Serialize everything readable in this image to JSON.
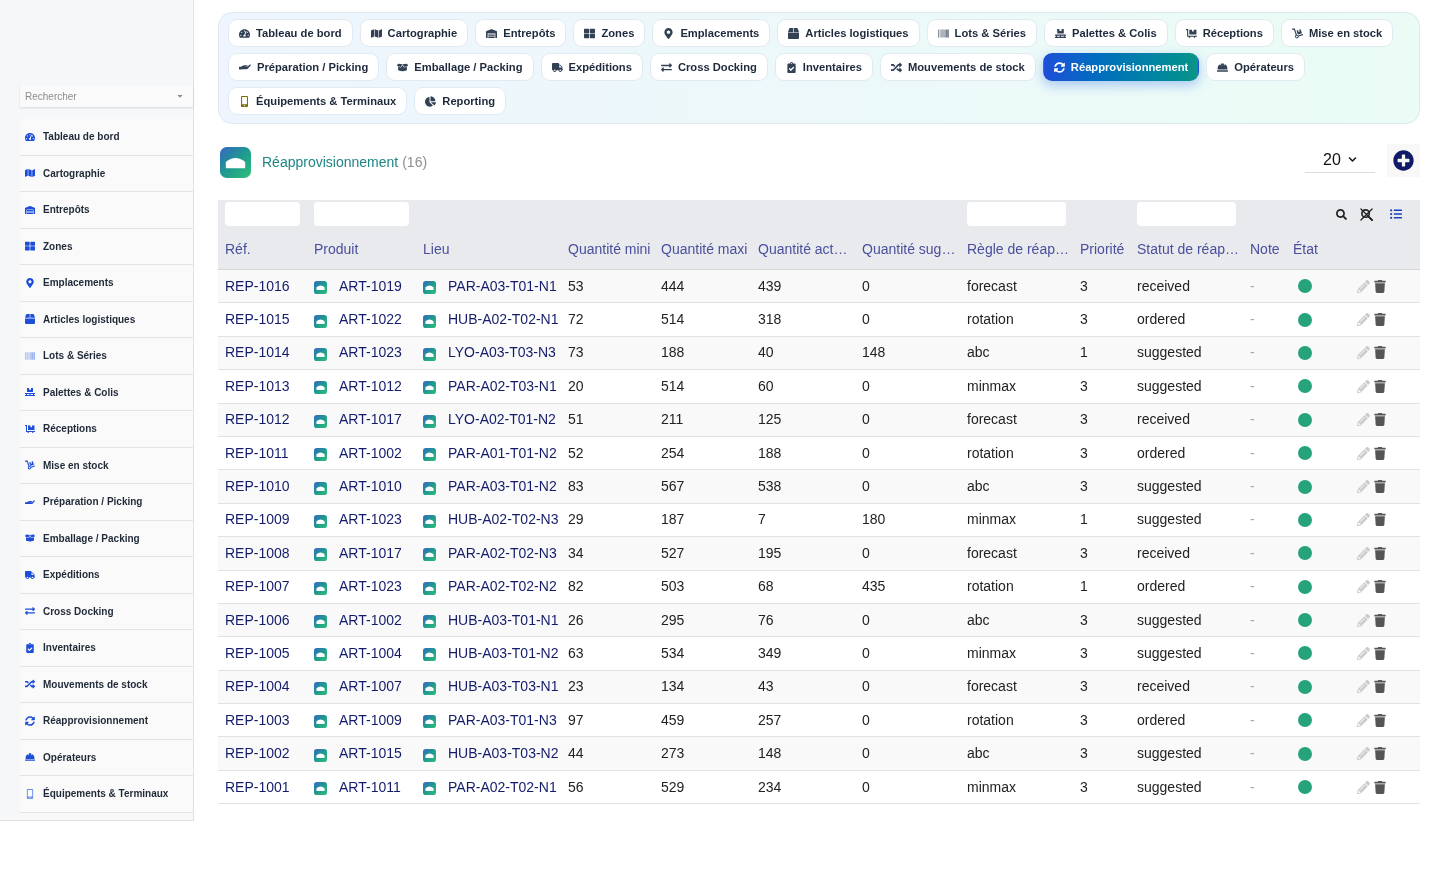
{
  "sidebar": {
    "search": {
      "placeholder": "Rechercher"
    },
    "items": [
      "Tableau de bord",
      "Cartographie",
      "Entrepôts",
      "Zones",
      "Emplacements",
      "Articles logistiques",
      "Lots & Séries",
      "Palettes & Colis",
      "Réceptions",
      "Mise en stock",
      "Préparation / Picking",
      "Emballage / Packing",
      "Expéditions",
      "Cross Docking",
      "Inventaires",
      "Mouvements de stock",
      "Réapprovisionnement",
      "Opérateurs",
      "Équipements & Terminaux"
    ]
  },
  "nav_tabs": [
    {
      "label": "Tableau de bord",
      "selected": false
    },
    {
      "label": "Cartographie",
      "selected": false
    },
    {
      "label": "Entrepôts",
      "selected": false
    },
    {
      "label": "Zones",
      "selected": false
    },
    {
      "label": "Emplacements",
      "selected": false
    },
    {
      "label": "Articles logistiques",
      "selected": false
    },
    {
      "label": "Lots & Séries",
      "selected": false
    },
    {
      "label": "Palettes & Colis",
      "selected": false
    },
    {
      "label": "Réceptions",
      "selected": false
    },
    {
      "label": "Mise en stock",
      "selected": false
    },
    {
      "label": "Préparation / Picking",
      "selected": false
    },
    {
      "label": "Emballage / Packing",
      "selected": false
    },
    {
      "label": "Expéditions",
      "selected": false
    },
    {
      "label": "Cross Docking",
      "selected": false
    },
    {
      "label": "Inventaires",
      "selected": false
    },
    {
      "label": "Mouvements de stock",
      "selected": false
    },
    {
      "label": "Réapprovisionnement",
      "selected": true
    },
    {
      "label": "Opérateurs",
      "selected": false
    },
    {
      "label": "Équipements & Terminaux",
      "selected": false
    },
    {
      "label": "Reporting",
      "selected": false
    }
  ],
  "header": {
    "title": "Réapprovisionnement",
    "count": "(16)",
    "page_size": "20"
  },
  "table": {
    "columns": [
      {
        "label": "Réf.",
        "filter": true
      },
      {
        "label": "Produit",
        "filter": true
      },
      {
        "label": "Lieu",
        "filter": false
      },
      {
        "label": "Quantité mini",
        "filter": false
      },
      {
        "label": "Quantité maxi",
        "filter": false
      },
      {
        "label": "Quantité act…",
        "filter": false
      },
      {
        "label": "Quantité sug…",
        "filter": false
      },
      {
        "label": "Règle de réap…",
        "filter": true
      },
      {
        "label": "Priorité",
        "filter": false
      },
      {
        "label": "Statut de réap…",
        "filter": true
      },
      {
        "label": "Note",
        "filter": false
      },
      {
        "label": "État",
        "filter": false
      }
    ],
    "rows": [
      {
        "ref": "REP-1016",
        "product": "ART-1019",
        "location": "PAR-A03-T01-N1",
        "qty_min": "53",
        "qty_max": "444",
        "qty_actual": "439",
        "qty_suggested": "0",
        "rule": "forecast",
        "priority": "3",
        "status": "received",
        "note": "-",
        "color": "#27a37c"
      },
      {
        "ref": "REP-1015",
        "product": "ART-1022",
        "location": "HUB-A02-T02-N1",
        "qty_min": "72",
        "qty_max": "514",
        "qty_actual": "318",
        "qty_suggested": "0",
        "rule": "rotation",
        "priority": "3",
        "status": "ordered",
        "note": "-",
        "color": "#27a37c"
      },
      {
        "ref": "REP-1014",
        "product": "ART-1023",
        "location": "LYO-A03-T03-N3",
        "qty_min": "73",
        "qty_max": "188",
        "qty_actual": "40",
        "qty_suggested": "148",
        "rule": "abc",
        "priority": "1",
        "status": "suggested",
        "note": "-",
        "color": "#27a37c"
      },
      {
        "ref": "REP-1013",
        "product": "ART-1012",
        "location": "PAR-A02-T03-N1",
        "qty_min": "20",
        "qty_max": "514",
        "qty_actual": "60",
        "qty_suggested": "0",
        "rule": "minmax",
        "priority": "3",
        "status": "suggested",
        "note": "-",
        "color": "#27a37c"
      },
      {
        "ref": "REP-1012",
        "product": "ART-1017",
        "location": "LYO-A02-T01-N2",
        "qty_min": "51",
        "qty_max": "211",
        "qty_actual": "125",
        "qty_suggested": "0",
        "rule": "forecast",
        "priority": "3",
        "status": "received",
        "note": "-",
        "color": "#27a37c"
      },
      {
        "ref": "REP-1011",
        "product": "ART-1002",
        "location": "PAR-A01-T01-N2",
        "qty_min": "52",
        "qty_max": "254",
        "qty_actual": "188",
        "qty_suggested": "0",
        "rule": "rotation",
        "priority": "3",
        "status": "ordered",
        "note": "-",
        "color": "#27a37c"
      },
      {
        "ref": "REP-1010",
        "product": "ART-1010",
        "location": "PAR-A03-T01-N2",
        "qty_min": "83",
        "qty_max": "567",
        "qty_actual": "538",
        "qty_suggested": "0",
        "rule": "abc",
        "priority": "3",
        "status": "suggested",
        "note": "-",
        "color": "#27a37c"
      },
      {
        "ref": "REP-1009",
        "product": "ART-1023",
        "location": "HUB-A02-T02-N3",
        "qty_min": "29",
        "qty_max": "187",
        "qty_actual": "7",
        "qty_suggested": "180",
        "rule": "minmax",
        "priority": "1",
        "status": "suggested",
        "note": "-",
        "color": "#27a37c"
      },
      {
        "ref": "REP-1008",
        "product": "ART-1017",
        "location": "PAR-A02-T02-N3",
        "qty_min": "34",
        "qty_max": "527",
        "qty_actual": "195",
        "qty_suggested": "0",
        "rule": "forecast",
        "priority": "3",
        "status": "received",
        "note": "-",
        "color": "#27a37c"
      },
      {
        "ref": "REP-1007",
        "product": "ART-1023",
        "location": "PAR-A02-T02-N2",
        "qty_min": "82",
        "qty_max": "503",
        "qty_actual": "68",
        "qty_suggested": "435",
        "rule": "rotation",
        "priority": "1",
        "status": "ordered",
        "note": "-",
        "color": "#27a37c"
      },
      {
        "ref": "REP-1006",
        "product": "ART-1002",
        "location": "HUB-A03-T01-N1",
        "qty_min": "26",
        "qty_max": "295",
        "qty_actual": "76",
        "qty_suggested": "0",
        "rule": "abc",
        "priority": "3",
        "status": "suggested",
        "note": "-",
        "color": "#27a37c"
      },
      {
        "ref": "REP-1005",
        "product": "ART-1004",
        "location": "HUB-A03-T01-N2",
        "qty_min": "63",
        "qty_max": "534",
        "qty_actual": "349",
        "qty_suggested": "0",
        "rule": "minmax",
        "priority": "3",
        "status": "suggested",
        "note": "-",
        "color": "#27a37c"
      },
      {
        "ref": "REP-1004",
        "product": "ART-1007",
        "location": "HUB-A03-T03-N1",
        "qty_min": "23",
        "qty_max": "134",
        "qty_actual": "43",
        "qty_suggested": "0",
        "rule": "forecast",
        "priority": "3",
        "status": "received",
        "note": "-",
        "color": "#27a37c"
      },
      {
        "ref": "REP-1003",
        "product": "ART-1009",
        "location": "PAR-A03-T01-N3",
        "qty_min": "97",
        "qty_max": "459",
        "qty_actual": "257",
        "qty_suggested": "0",
        "rule": "rotation",
        "priority": "3",
        "status": "ordered",
        "note": "-",
        "color": "#27a37c"
      },
      {
        "ref": "REP-1002",
        "product": "ART-1015",
        "location": "HUB-A03-T03-N2",
        "qty_min": "44",
        "qty_max": "273",
        "qty_actual": "148",
        "qty_suggested": "0",
        "rule": "abc",
        "priority": "3",
        "status": "suggested",
        "note": "-",
        "color": "#27a37c"
      },
      {
        "ref": "REP-1001",
        "product": "ART-1011",
        "location": "PAR-A02-T02-N1",
        "qty_min": "56",
        "qty_max": "529",
        "qty_actual": "234",
        "qty_suggested": "0",
        "rule": "minmax",
        "priority": "3",
        "status": "suggested",
        "note": "-",
        "color": "#27a37c"
      }
    ]
  }
}
